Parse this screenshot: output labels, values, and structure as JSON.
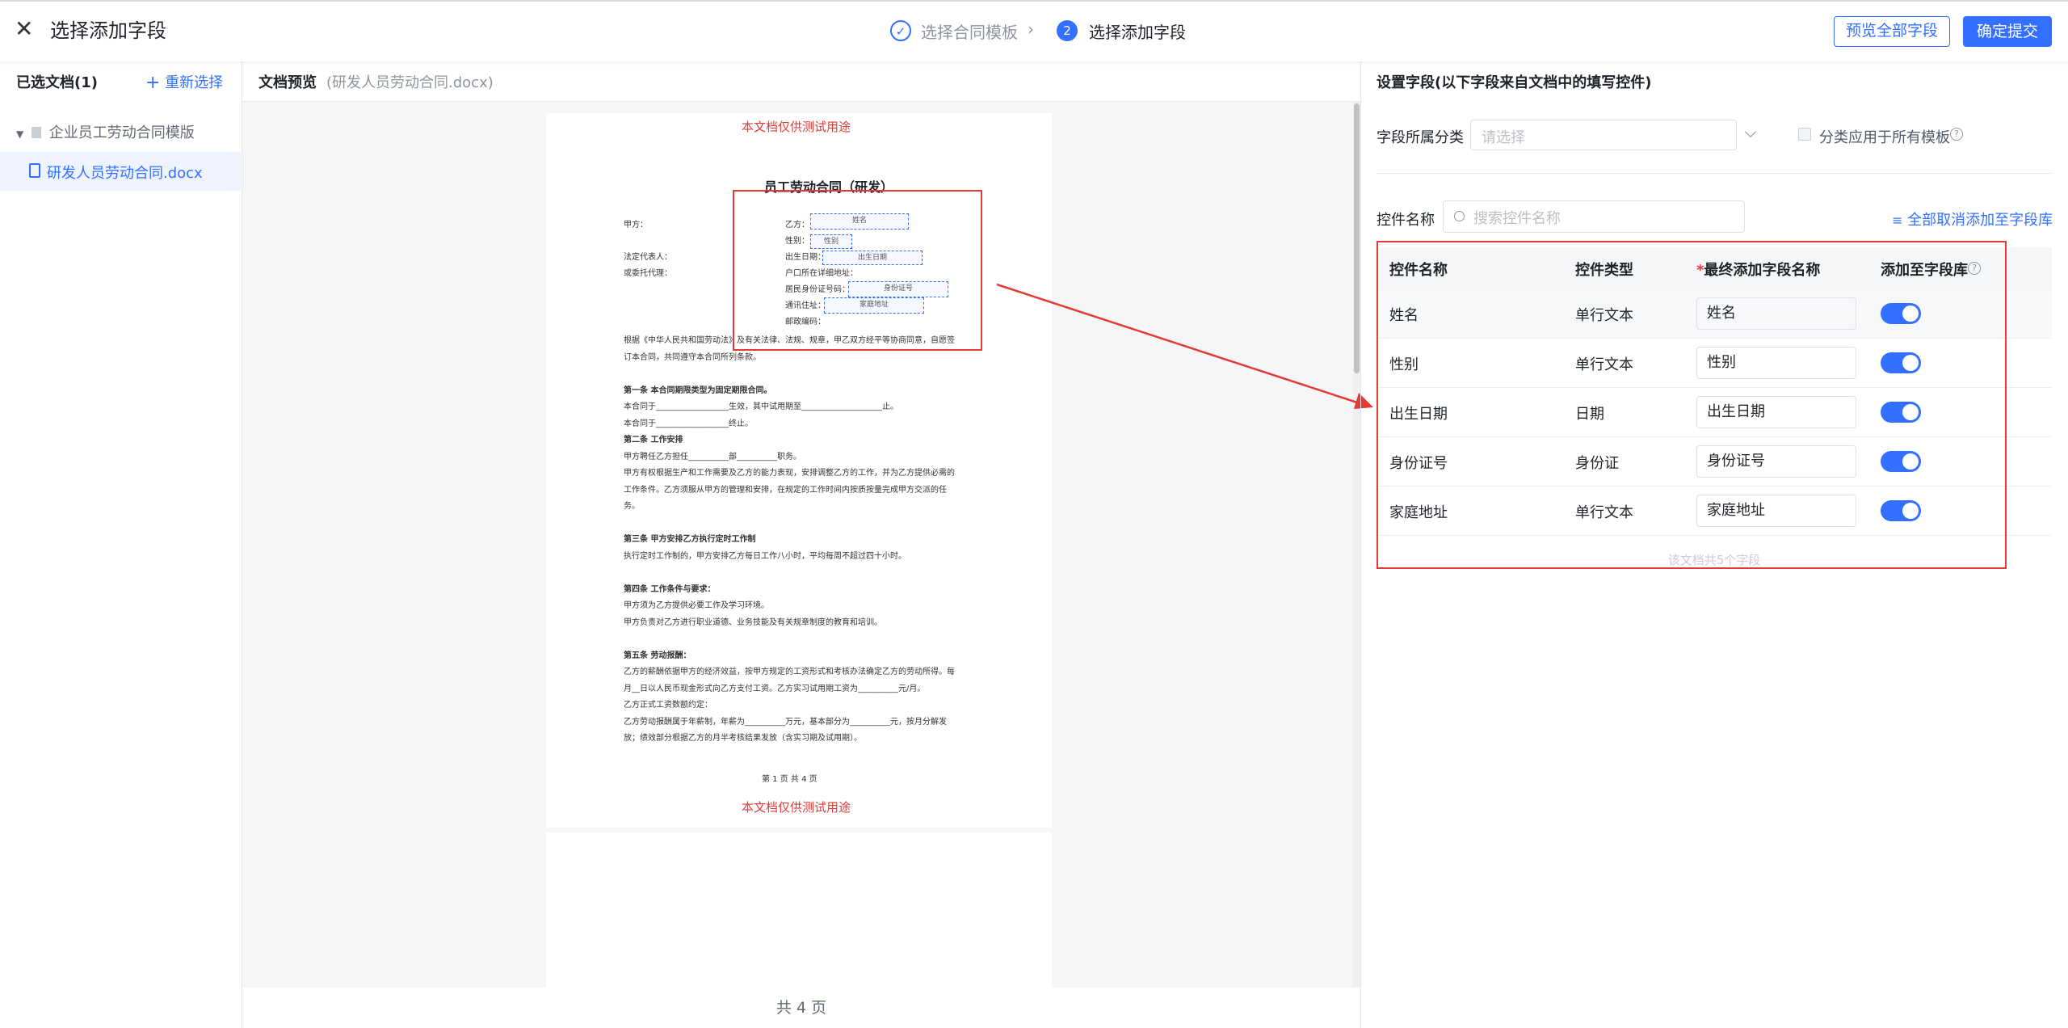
{
  "header": {
    "title": "选择添加字段",
    "steps": [
      {
        "index": "✓",
        "label": "选择合同模板"
      },
      {
        "index": "2",
        "label": "选择添加字段"
      }
    ],
    "preview_all": "预览全部字段",
    "confirm": "确定提交"
  },
  "left": {
    "title": "已选文档(1)",
    "reselect": "重新选择",
    "group": "企业员工劳动合同模版",
    "file": "研发人员劳动合同.docx"
  },
  "middle": {
    "title": "文档预览",
    "subtitle": "(研发人员劳动合同.docx)",
    "pager": "共 4 页",
    "doc": {
      "watermark": "本文档仅供测试用途",
      "title": "员工劳动合同（研发）",
      "jia": "甲方：",
      "rep": "法定代表人：",
      "agent": "或委托代理：",
      "yi": "乙方：",
      "gender": "性别：",
      "birth": "出生日期：",
      "hukou": "户口所在详细地址：",
      "idno": "居民身份证号码：",
      "addr": "通讯住址：",
      "zip": "邮政编码：",
      "f_name": "姓名",
      "f_gender": "性别",
      "f_birth": "出生日期",
      "f_id": "身份证号",
      "f_addr": "家庭地址",
      "lines": [
        {
          "t": "根据《中华人民共和国劳动法》及有关法律、法规、规章，甲乙双方经平等协商同意，自愿签",
          "b": false
        },
        {
          "t": "订本合同，共同遵守本合同所列条款。",
          "b": false
        },
        {
          "t": "",
          "b": false
        },
        {
          "t": "第一条  本合同期限类型为固定期限合同。",
          "b": true
        },
        {
          "t": "本合同于__________________生效，其中试用期至____________________止。",
          "b": false
        },
        {
          "t": "本合同于__________________终止。",
          "b": false
        },
        {
          "t": "第二条  工作安排",
          "b": true
        },
        {
          "t": "甲方聘任乙方担任__________部__________职务。",
          "b": false
        },
        {
          "t": "甲方有权根据生产和工作需要及乙方的能力表现，安排调整乙方的工作，并为乙方提供必需的",
          "b": false
        },
        {
          "t": "工作条件。乙方须服从甲方的管理和安排，在规定的工作时间内按质按量完成甲方交派的任",
          "b": false
        },
        {
          "t": "务。",
          "b": false
        },
        {
          "t": "",
          "b": false
        },
        {
          "t": "第三条  甲方安排乙方执行定时工作制",
          "b": true
        },
        {
          "t": "执行定时工作制的，甲方安排乙方每日工作八小时，平均每周不超过四十小时。",
          "b": false
        },
        {
          "t": "",
          "b": false
        },
        {
          "t": "第四条  工作条件与要求：",
          "b": true
        },
        {
          "t": "甲方须为乙方提供必要工作及学习环境。",
          "b": false
        },
        {
          "t": "甲方负责对乙方进行职业道德、业务技能及有关规章制度的教育和培训。",
          "b": false
        },
        {
          "t": "",
          "b": false
        },
        {
          "t": "第五条  劳动报酬：",
          "b": true
        },
        {
          "t": "乙方的薪酬依据甲方的经济效益，按甲方规定的工资形式和考核办法确定乙方的劳动所得。每",
          "b": false
        },
        {
          "t": "月__日以人民币现金形式向乙方支付工资。乙方实习试用期工资为__________元/月。",
          "b": false
        },
        {
          "t": "乙方正式工资数额约定：",
          "b": false
        },
        {
          "t": "乙方劳动报酬属于年薪制，年薪为__________万元，基本部分为__________元，按月分解发",
          "b": false
        },
        {
          "t": "放；绩效部分根据乙方的月半考核结果发放（含实习期及试用期）。",
          "b": false
        }
      ],
      "page_no": "第 1 页 共 4 页"
    }
  },
  "right": {
    "title": "设置字段(以下字段来自文档中的填写控件)",
    "category_label": "字段所属分类",
    "category_placeholder": "请选择",
    "apply_all": "分类应用于所有模板",
    "control_name_label": "控件名称",
    "search_placeholder": "搜索控件名称",
    "cancel_all": "全部取消添加至字段库",
    "columns": [
      "控件名称",
      "控件类型",
      "最终添加字段名称",
      "添加至字段库"
    ],
    "required_mark": "*",
    "rows": [
      {
        "name": "姓名",
        "type": "单行文本",
        "field": "姓名",
        "on": true
      },
      {
        "name": "性别",
        "type": "单行文本",
        "field": "性别",
        "on": true
      },
      {
        "name": "出生日期",
        "type": "日期",
        "field": "出生日期",
        "on": true
      },
      {
        "name": "身份证号",
        "type": "身份证",
        "field": "身份证号",
        "on": true
      },
      {
        "name": "家庭地址",
        "type": "单行文本",
        "field": "家庭地址",
        "on": true
      }
    ],
    "footer": "该文档共5个字段"
  },
  "colors": {
    "accent": "#3370ff",
    "annotation": "#e53935"
  }
}
